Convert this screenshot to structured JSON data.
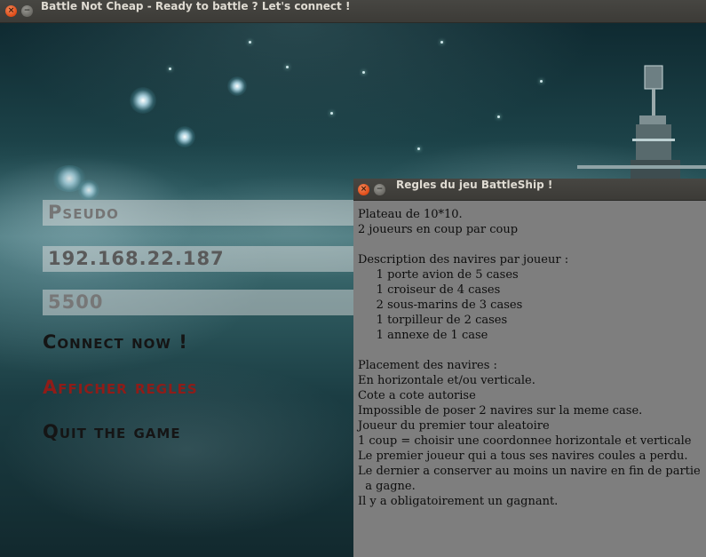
{
  "main_window": {
    "title": "Battle Not Cheap - Ready to battle ? Let's connect !",
    "close_glyph": "×",
    "min_glyph": "−"
  },
  "form": {
    "pseudo_placeholder": "Pseudo",
    "ip_value": "192.168.22.187",
    "port_value": "5500",
    "connect_label": "Connect now !",
    "rules_label": "Afficher regles",
    "quit_label": "Quit the game"
  },
  "colors": {
    "connect": "#151515",
    "rules": "#8f1c18",
    "quit": "#151515"
  },
  "rules_dialog": {
    "title": "Regles du jeu BattleShip !",
    "lines": [
      "Plateau de 10*10.",
      "2 joueurs en coup par coup",
      "",
      "Description des navires par joueur :",
      "     1 porte avion de 5 cases",
      "     1 croiseur de 4 cases",
      "     2 sous-marins de 3 cases",
      "     1 torpilleur de 2 cases",
      "     1 annexe de 1 case",
      "",
      "Placement des navires :",
      "En horizontale et/ou verticale.",
      "Cote a cote autorise",
      "Impossible de poser 2 navires sur la meme case.",
      "Joueur du premier tour aleatoire",
      "1 coup = choisir une coordonnee horizontale et verticale",
      "Le premier joueur qui a tous ses navires coules a perdu.",
      "Le dernier a conserver au moins un navire en fin de partie",
      "  a gagne.",
      "Il y a obligatoirement un gagnant."
    ]
  }
}
